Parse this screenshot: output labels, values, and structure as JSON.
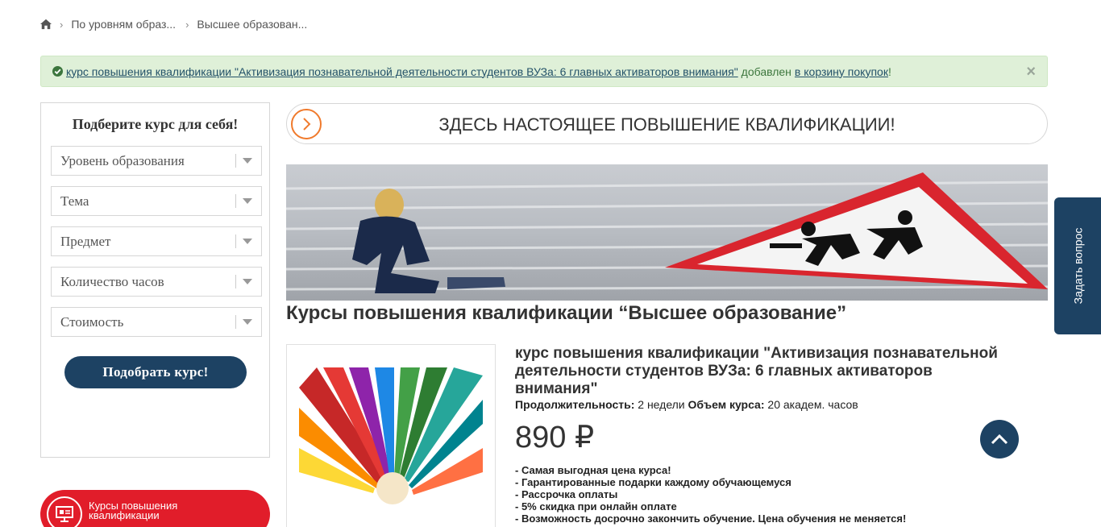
{
  "breadcrumb": {
    "items": [
      "По уровням образ...",
      "Высшее образован..."
    ]
  },
  "alert": {
    "link_text": "курс повышения квалификации \"Активизация познавательной деятельности студентов ВУЗа: 6 главных активаторов внимания\"",
    "middle_text": "добавлен",
    "cart_link": "в корзину покупок",
    "end_text": "!",
    "close_label": "×"
  },
  "filter": {
    "heading": "Подберите курс для себя!",
    "selects": [
      {
        "label": "Уровень образования"
      },
      {
        "label": "Тема"
      },
      {
        "label": "Предмет"
      },
      {
        "label": "Количество часов"
      },
      {
        "label": "Стоимость"
      }
    ],
    "button_label": "Подобрать курс!"
  },
  "courses_pill": {
    "label": "Курсы повышения квалификации"
  },
  "banner": {
    "title": "ЗДЕСЬ НАСТОЯЩЕЕ ПОВЫШЕНИЕ КВАЛИФИКАЦИИ!"
  },
  "page_title": "Курсы повышения квалификации “Высшее образование”",
  "product": {
    "title": "курс повышения квалификации \"Активизация познавательной деятельности студентов ВУЗа: 6 главных активаторов внимания\"",
    "duration_label": "Продолжительность:",
    "duration_value": "2 недели",
    "volume_label": "Объем курса:",
    "volume_value": "20 академ. часов",
    "price": "890 ₽",
    "benefits": [
      "- Самая выгодная цена курса!",
      "- Гарантированные подарки каждому обучающемуся",
      "- Рассрочка оплаты",
      "- 5% скидка при онлайн оплате",
      "- Возможность досрочно закончить обучение. Цена обучения не меняется!"
    ]
  },
  "ask_tab": {
    "label": "Задать вопрос"
  },
  "colors": {
    "navy": "#1d4263",
    "red": "#e11d2a",
    "orange": "#f07a2c",
    "alert_bg": "#dff0d8"
  }
}
